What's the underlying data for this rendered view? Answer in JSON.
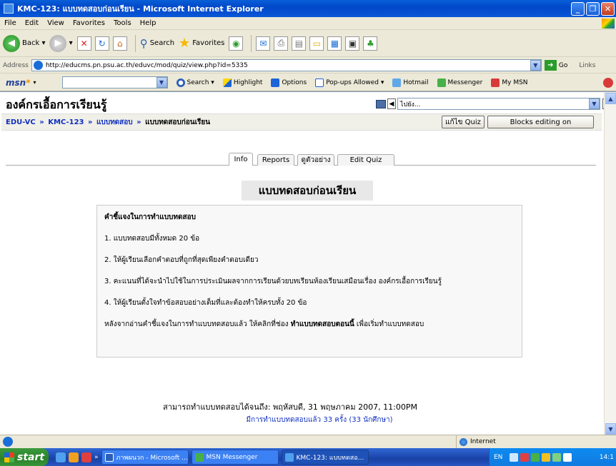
{
  "window": {
    "title": "KMC-123: แบบทดสอบก่อนเรียน - Microsoft Internet Explorer",
    "minimize": "_",
    "restore": "❐",
    "close": "✕"
  },
  "menu": [
    "File",
    "Edit",
    "View",
    "Favorites",
    "Tools",
    "Help"
  ],
  "toolbar": {
    "back": "Back",
    "search": "Search",
    "favorites": "Favorites"
  },
  "address": {
    "label": "Address",
    "url": "http://educms.pn.psu.ac.th/eduvc/mod/quiz/view.php?id=5335",
    "go": "Go",
    "links": "Links"
  },
  "msn": {
    "logo": "msn",
    "search": "Search",
    "highlight": "Highlight",
    "options": "Options",
    "popups": "Pop-ups Allowed",
    "hotmail": "Hotmail",
    "messenger": "Messenger",
    "mymsn": "My MSN"
  },
  "page": {
    "site_title": "องค์กรเอื้อการเรียนรู้",
    "jump_select": "ไปยัง...",
    "breadcrumb": {
      "items": [
        "EDU-VC",
        "KMC-123",
        "แบบทดสอบ"
      ],
      "separator": "»",
      "current": "แบบทดสอบก่อนเรียน"
    },
    "buttons": {
      "edit_quiz": "แก้ไข Quiz",
      "blocks_editing": "Blocks editing on"
    },
    "tabs": [
      "Info",
      "Reports",
      "ดูตัวอย่าง",
      "Edit Quiz"
    ],
    "quiz_title": "แบบทดสอบก่อนเรียน",
    "instructions": {
      "heading": "คำชี้แจงในการทำแบบทดสอบ",
      "items": [
        "1. แบบทดสอบมีทั้งหมด 20 ข้อ",
        "2. ให้ผู้เรียนเลือกคำตอบที่ถูกที่สุดเพียงคำตอบเดียว",
        "3. คะแนนที่ได้จะนำไปใช้ในการประเมินผลจากการเรียนด้วยบทเรียนห้องเรียนเสมือนเรื่อง   องค์กรเอื้อการเรียนรู้",
        "4. ให้ผู้เรียนตั้งใจทำข้อสอบอย่างเต็มที่และต้องทำให้ครบทั้ง 20 ข้อ"
      ],
      "closing_before": "หลังจากอ่านคำชี้แจงในการทำแบบทดสอบแล้ว ให้คลิกที่ช่อง ",
      "closing_bold": "ทำแบบทดสอบตอนนี้",
      "closing_after": " เพื่อเริ่มทำแบบทดสอบ"
    },
    "close_time": "สามารถทำแบบทดสอบได้จนถึง: พฤหัสบดี, 31 พฤษภาคม 2007, 11:00PM",
    "attempts_link": "มีการทำแบบทดสอบแล้ว 33 ครั้ง (33 นักศึกษา)"
  },
  "status": {
    "zone": "Internet"
  },
  "taskbar": {
    "start": "start",
    "items": [
      "ภาพผนวก - Microsoft ...",
      "MSN Messenger",
      "KMC-123: แบบทดสอ..."
    ],
    "lang": "EN",
    "clock": "14:1"
  }
}
